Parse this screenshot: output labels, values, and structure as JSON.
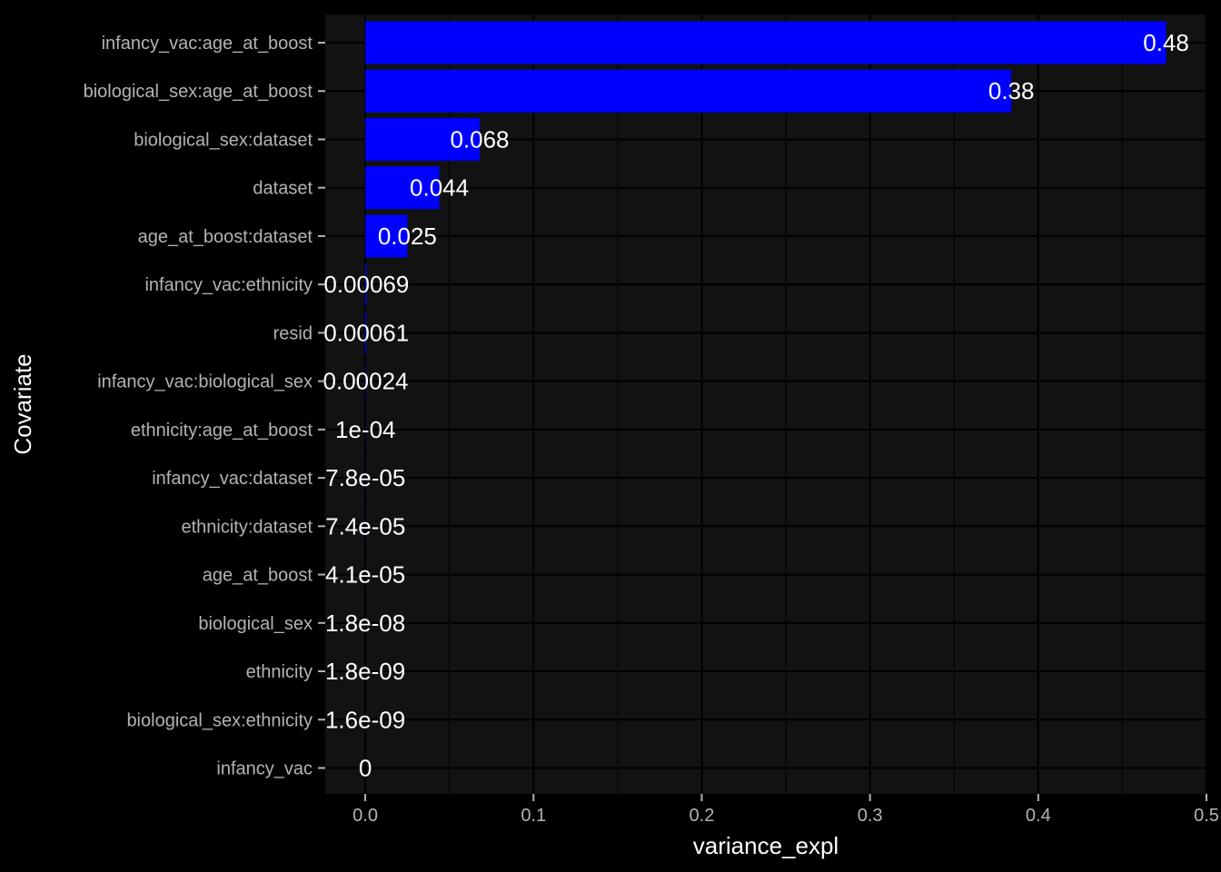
{
  "chart_data": {
    "type": "bar",
    "orientation": "horizontal",
    "xlabel": "variance_expl",
    "ylabel": "Covariate",
    "xlim": [
      -0.0238,
      0.5
    ],
    "x_ticks": [
      0.0,
      0.1,
      0.2,
      0.3,
      0.4,
      0.5
    ],
    "x_tick_labels": [
      "0.0",
      "0.1",
      "0.2",
      "0.3",
      "0.4",
      "0.5"
    ],
    "grid": true,
    "bar_color": "#0000ff",
    "panel_color": "#121212",
    "background_color": "#000000",
    "categories": [
      "infancy_vac:age_at_boost",
      "biological_sex:age_at_boost",
      "biological_sex:dataset",
      "dataset",
      "age_at_boost:dataset",
      "infancy_vac:ethnicity",
      "resid",
      "infancy_vac:biological_sex",
      "ethnicity:age_at_boost",
      "infancy_vac:dataset",
      "ethnicity:dataset",
      "age_at_boost",
      "biological_sex",
      "ethnicity",
      "biological_sex:ethnicity",
      "infancy_vac"
    ],
    "values": [
      0.476,
      0.384,
      0.068,
      0.044,
      0.025,
      0.00069,
      0.00061,
      0.00024,
      0.0001,
      7.8e-05,
      7.4e-05,
      4.1e-05,
      1.8e-08,
      1.8e-09,
      1.6e-09,
      0
    ],
    "value_labels": [
      "0.48",
      "0.38",
      "0.068",
      "0.044",
      "0.025",
      "0.00069",
      "0.00061",
      "0.00024",
      "1e-04",
      "7.8e-05",
      "7.4e-05",
      "4.1e-05",
      "1.8e-08",
      "1.8e-09",
      "1.6e-09",
      "0"
    ]
  }
}
